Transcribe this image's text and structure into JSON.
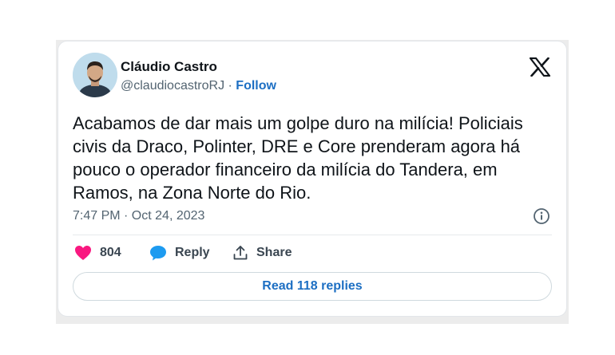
{
  "author": {
    "name": "Cláudio Castro",
    "handle": "@claudiocastroRJ",
    "separator": " · ",
    "follow_label": "Follow",
    "avatar_icon": "user-avatar-photo"
  },
  "platform_icon": "x-logo-icon",
  "tweet": {
    "text": "Acabamos de dar mais um golpe duro na milícia! Policiais civis da Draco, Polinter, DRE e Core prenderam agora há pouco o operador financeiro da milícia do Tandera, em Ramos, na Zona Norte do Rio.",
    "timestamp": "7:47 PM · Oct 24, 2023"
  },
  "actions": {
    "likes_count": "804",
    "reply_label": "Reply",
    "share_label": "Share"
  },
  "read_replies_label": "Read 118 replies",
  "colors": {
    "like": "#f91880",
    "reply": "#1d9bf0",
    "link": "#1d6fc3",
    "text": "#0f1419",
    "muted": "#536471"
  }
}
